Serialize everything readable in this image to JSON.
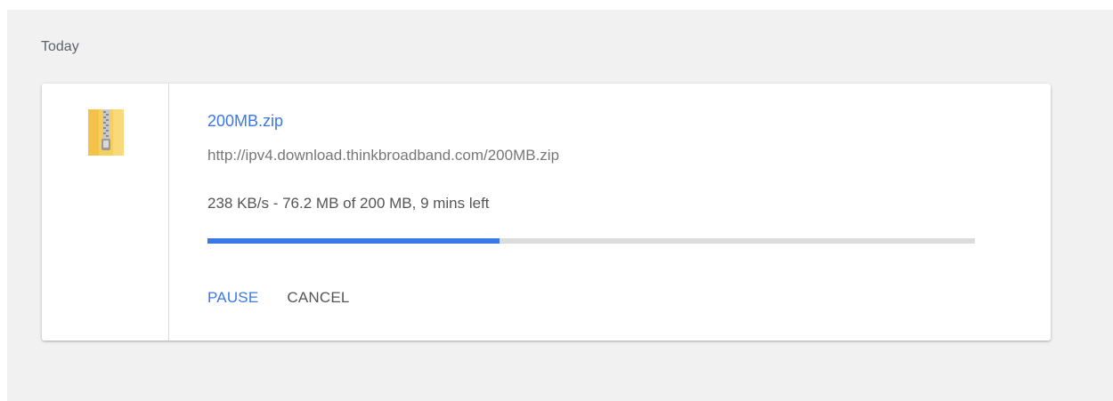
{
  "section": {
    "label": "Today"
  },
  "download": {
    "file_name": "200MB.zip",
    "url": "http://ipv4.download.thinkbroadband.com/200MB.zip",
    "status": "238 KB/s - 76.2 MB of 200 MB, 9 mins left",
    "progress_fraction": 0.381,
    "icon": "zip-archive-icon",
    "actions": {
      "pause_label": "PAUSE",
      "cancel_label": "CANCEL"
    }
  },
  "colors": {
    "accent": "#3b78e7",
    "page_background": "#f1f1f1",
    "card_background": "#ffffff",
    "progress_track": "#dcdcdc",
    "icon_yellow": "#f7cf5d"
  }
}
